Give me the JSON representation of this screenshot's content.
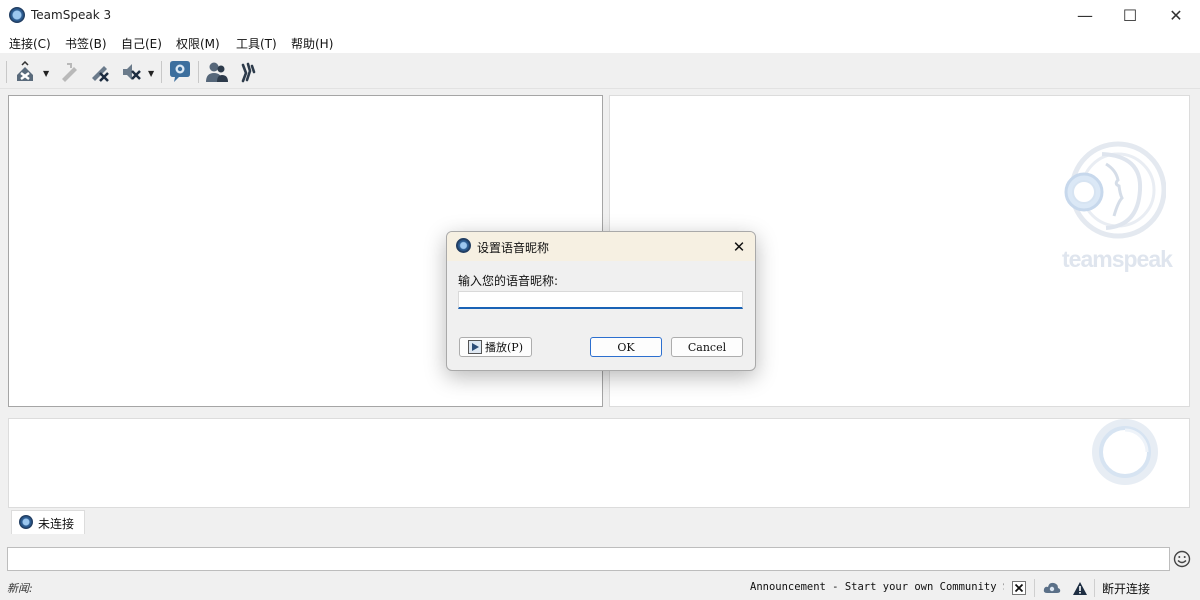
{
  "window": {
    "title": "TeamSpeak 3",
    "controls": {
      "minimize": "—",
      "maximize": "☐",
      "close": "✕"
    }
  },
  "menu": {
    "items": [
      "连接(C)",
      "书签(B)",
      "自己(E)",
      "权限(M)",
      "工具(T)",
      "帮助(H)"
    ]
  },
  "toolbar": {
    "buttons": [
      {
        "icon": "disconnect-icon",
        "has_dropdown": true
      },
      {
        "icon": "away-icon"
      },
      {
        "icon": "mute-microphone-icon"
      },
      {
        "icon": "mute-speakers-icon",
        "has_dropdown": true
      },
      {
        "icon": "subscribe-chat-icon"
      },
      {
        "icon": "contacts-icon"
      },
      {
        "icon": "whisper-icon"
      }
    ]
  },
  "watermark": {
    "text": "teamspeak"
  },
  "tabs": [
    {
      "label": "未连接",
      "icon": "teamspeak-logo-icon"
    }
  ],
  "dialog": {
    "title": "设置语音昵称",
    "label": "输入您的语音昵称:",
    "input_value": "",
    "play_button": "播放(P)",
    "ok_button": "OK",
    "cancel_button": "Cancel"
  },
  "status": {
    "news_label": "新闻:",
    "ticker": "Announcement - Start your own Community Se",
    "disconnect_label": "断开连接"
  },
  "colors": {
    "accent": "#1a63b6",
    "dialog_title_bg": "#f6f0e2"
  }
}
